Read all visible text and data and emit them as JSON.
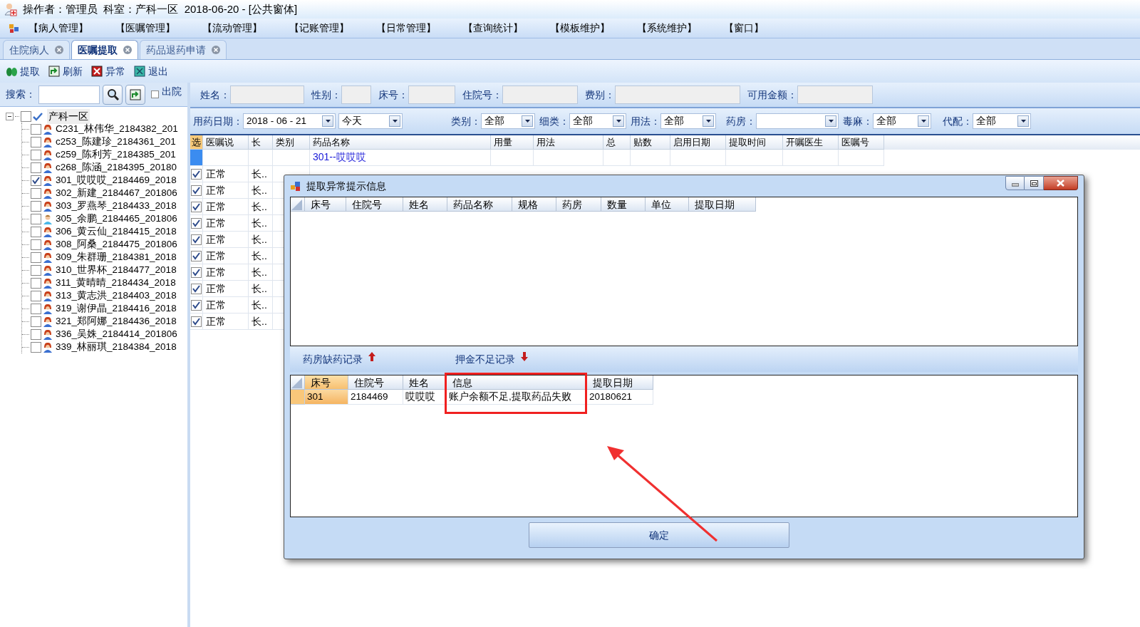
{
  "window": {
    "title": "操作者：管理员  科室：产科一区  2018-06-20 - [公共窗体]"
  },
  "menu": [
    "【病人管理】",
    "【医嘱管理】",
    "【流动管理】",
    "【记账管理】",
    "【日常管理】",
    "【查询统计】",
    "【模板维护】",
    "【系统维护】",
    "【窗口】"
  ],
  "tabs": [
    {
      "label": "住院病人",
      "selected": false
    },
    {
      "label": "医嘱提取",
      "selected": true
    },
    {
      "label": "药品退药申请",
      "selected": false
    }
  ],
  "toolbar": [
    {
      "kind": "extract",
      "label": "提取"
    },
    {
      "kind": "refresh",
      "label": "刷新"
    },
    {
      "kind": "error",
      "label": "异常"
    },
    {
      "kind": "exit",
      "label": "退出"
    }
  ],
  "search": {
    "label": "搜索：",
    "discharged": {
      "label": "出院",
      "checked": false
    }
  },
  "tree": {
    "label": "产科一区",
    "checked": false,
    "expanded": true,
    "children": [
      {
        "label": "C231_林伟华_2184382_201",
        "checked": false,
        "kind": "female"
      },
      {
        "label": "c253_陈建珍_2184361_201",
        "checked": false,
        "kind": "female"
      },
      {
        "label": "c259_陈利芳_2184385_201",
        "checked": false,
        "kind": "female"
      },
      {
        "label": "c268_陈涵_2184395_20180",
        "checked": false,
        "kind": "female"
      },
      {
        "label": "301_哎哎哎_2184469_2018",
        "checked": true,
        "kind": "female"
      },
      {
        "label": "302_新建_2184467_201806",
        "checked": false,
        "kind": "female"
      },
      {
        "label": "303_罗燕琴_2184433_2018",
        "checked": false,
        "kind": "female"
      },
      {
        "label": "305_余鹏_2184465_201806",
        "checked": false,
        "kind": "male"
      },
      {
        "label": "306_黄云仙_2184415_2018",
        "checked": false,
        "kind": "female"
      },
      {
        "label": "308_阿桑_2184475_201806",
        "checked": false,
        "kind": "female"
      },
      {
        "label": "309_朱群珊_2184381_2018",
        "checked": false,
        "kind": "female"
      },
      {
        "label": "310_世界杯_2184477_2018",
        "checked": false,
        "kind": "female"
      },
      {
        "label": "311_黄晴晴_2184434_2018",
        "checked": false,
        "kind": "female"
      },
      {
        "label": "313_黄志洪_2184403_2018",
        "checked": false,
        "kind": "female"
      },
      {
        "label": "319_谢伊晶_2184416_2018",
        "checked": false,
        "kind": "female"
      },
      {
        "label": "321_郑阿娜_2184436_2018",
        "checked": false,
        "kind": "female"
      },
      {
        "label": "336_吴姝_2184414_201806",
        "checked": false,
        "kind": "female"
      },
      {
        "label": "339_林丽琪_2184384_2018",
        "checked": false,
        "kind": "female"
      }
    ]
  },
  "patient_info": [
    {
      "label": "姓名："
    },
    {
      "label": "性别："
    },
    {
      "label": "床号："
    },
    {
      "label": "住院号："
    },
    {
      "label": "费别："
    },
    {
      "label": "可用金额："
    }
  ],
  "filters": {
    "date_label": "用药日期：",
    "date": "2018 - 06 - 21",
    "period": "今天",
    "selects": [
      {
        "label": "类别：",
        "value": "全部"
      },
      {
        "label": "细类：",
        "value": "全部"
      },
      {
        "label": "用法：",
        "value": "全部"
      },
      {
        "label": "药房："
      },
      {
        "label": "毒麻：",
        "value": "全部"
      },
      {
        "label": "代配：",
        "value": "全部"
      }
    ]
  },
  "orders_table": {
    "columns": [
      "选",
      "医嘱说",
      "长",
      "类别",
      "药品名称",
      "用量",
      "用法",
      "总",
      "贴数",
      "启用日期",
      "提取时间",
      "开嘱医生",
      "医嘱号"
    ],
    "group_row": "301--哎哎哎",
    "rows": [
      {
        "checked": true,
        "status": "正常",
        "type": "长.."
      },
      {
        "checked": true,
        "status": "正常",
        "type": "长.."
      },
      {
        "checked": true,
        "status": "正常",
        "type": "长.."
      },
      {
        "checked": true,
        "status": "正常",
        "type": "长.."
      },
      {
        "checked": true,
        "status": "正常",
        "type": "长.."
      },
      {
        "checked": true,
        "status": "正常",
        "type": "长.."
      },
      {
        "checked": true,
        "status": "正常",
        "type": "长.."
      },
      {
        "checked": true,
        "status": "正常",
        "type": "长.."
      },
      {
        "checked": true,
        "status": "正常",
        "type": "长.."
      },
      {
        "checked": true,
        "status": "正常",
        "type": "长.."
      }
    ]
  },
  "dialog": {
    "title": "提取异常提示信息",
    "shortage_table": {
      "columns": [
        "床号",
        "住院号",
        "姓名",
        "药品名称",
        "规格",
        "药房",
        "数量",
        "单位",
        "提取日期"
      ]
    },
    "shortage_label": "药房缺药记录",
    "deposit_label": "押金不足记录",
    "deposit_table": {
      "columns": [
        "床号",
        "住院号",
        "姓名",
        "信息",
        "提取日期"
      ],
      "rows": [
        {
          "cells": [
            "301",
            "2184469",
            "哎哎哎",
            "账户余额不足,提取药品失败",
            "20180621"
          ],
          "selected": true
        }
      ]
    },
    "ok_button": "确定"
  },
  "annotations": {
    "highlight_box": true,
    "arrow": true
  }
}
